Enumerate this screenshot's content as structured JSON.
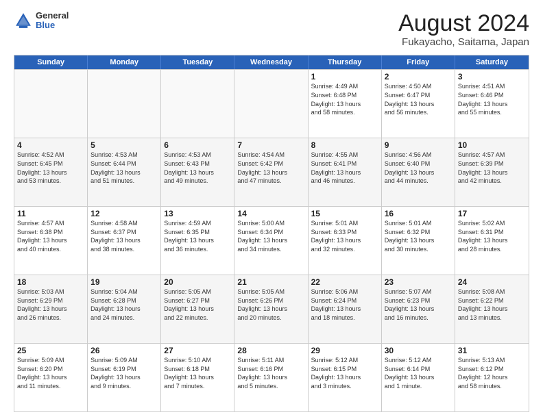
{
  "logo": {
    "general": "General",
    "blue": "Blue"
  },
  "title": "August 2024",
  "subtitle": "Fukayacho, Saitama, Japan",
  "header_days": [
    "Sunday",
    "Monday",
    "Tuesday",
    "Wednesday",
    "Thursday",
    "Friday",
    "Saturday"
  ],
  "weeks": [
    [
      {
        "num": "",
        "detail": ""
      },
      {
        "num": "",
        "detail": ""
      },
      {
        "num": "",
        "detail": ""
      },
      {
        "num": "",
        "detail": ""
      },
      {
        "num": "1",
        "detail": "Sunrise: 4:49 AM\nSunset: 6:48 PM\nDaylight: 13 hours\nand 58 minutes."
      },
      {
        "num": "2",
        "detail": "Sunrise: 4:50 AM\nSunset: 6:47 PM\nDaylight: 13 hours\nand 56 minutes."
      },
      {
        "num": "3",
        "detail": "Sunrise: 4:51 AM\nSunset: 6:46 PM\nDaylight: 13 hours\nand 55 minutes."
      }
    ],
    [
      {
        "num": "4",
        "detail": "Sunrise: 4:52 AM\nSunset: 6:45 PM\nDaylight: 13 hours\nand 53 minutes."
      },
      {
        "num": "5",
        "detail": "Sunrise: 4:53 AM\nSunset: 6:44 PM\nDaylight: 13 hours\nand 51 minutes."
      },
      {
        "num": "6",
        "detail": "Sunrise: 4:53 AM\nSunset: 6:43 PM\nDaylight: 13 hours\nand 49 minutes."
      },
      {
        "num": "7",
        "detail": "Sunrise: 4:54 AM\nSunset: 6:42 PM\nDaylight: 13 hours\nand 47 minutes."
      },
      {
        "num": "8",
        "detail": "Sunrise: 4:55 AM\nSunset: 6:41 PM\nDaylight: 13 hours\nand 46 minutes."
      },
      {
        "num": "9",
        "detail": "Sunrise: 4:56 AM\nSunset: 6:40 PM\nDaylight: 13 hours\nand 44 minutes."
      },
      {
        "num": "10",
        "detail": "Sunrise: 4:57 AM\nSunset: 6:39 PM\nDaylight: 13 hours\nand 42 minutes."
      }
    ],
    [
      {
        "num": "11",
        "detail": "Sunrise: 4:57 AM\nSunset: 6:38 PM\nDaylight: 13 hours\nand 40 minutes."
      },
      {
        "num": "12",
        "detail": "Sunrise: 4:58 AM\nSunset: 6:37 PM\nDaylight: 13 hours\nand 38 minutes."
      },
      {
        "num": "13",
        "detail": "Sunrise: 4:59 AM\nSunset: 6:35 PM\nDaylight: 13 hours\nand 36 minutes."
      },
      {
        "num": "14",
        "detail": "Sunrise: 5:00 AM\nSunset: 6:34 PM\nDaylight: 13 hours\nand 34 minutes."
      },
      {
        "num": "15",
        "detail": "Sunrise: 5:01 AM\nSunset: 6:33 PM\nDaylight: 13 hours\nand 32 minutes."
      },
      {
        "num": "16",
        "detail": "Sunrise: 5:01 AM\nSunset: 6:32 PM\nDaylight: 13 hours\nand 30 minutes."
      },
      {
        "num": "17",
        "detail": "Sunrise: 5:02 AM\nSunset: 6:31 PM\nDaylight: 13 hours\nand 28 minutes."
      }
    ],
    [
      {
        "num": "18",
        "detail": "Sunrise: 5:03 AM\nSunset: 6:29 PM\nDaylight: 13 hours\nand 26 minutes."
      },
      {
        "num": "19",
        "detail": "Sunrise: 5:04 AM\nSunset: 6:28 PM\nDaylight: 13 hours\nand 24 minutes."
      },
      {
        "num": "20",
        "detail": "Sunrise: 5:05 AM\nSunset: 6:27 PM\nDaylight: 13 hours\nand 22 minutes."
      },
      {
        "num": "21",
        "detail": "Sunrise: 5:05 AM\nSunset: 6:26 PM\nDaylight: 13 hours\nand 20 minutes."
      },
      {
        "num": "22",
        "detail": "Sunrise: 5:06 AM\nSunset: 6:24 PM\nDaylight: 13 hours\nand 18 minutes."
      },
      {
        "num": "23",
        "detail": "Sunrise: 5:07 AM\nSunset: 6:23 PM\nDaylight: 13 hours\nand 16 minutes."
      },
      {
        "num": "24",
        "detail": "Sunrise: 5:08 AM\nSunset: 6:22 PM\nDaylight: 13 hours\nand 13 minutes."
      }
    ],
    [
      {
        "num": "25",
        "detail": "Sunrise: 5:09 AM\nSunset: 6:20 PM\nDaylight: 13 hours\nand 11 minutes."
      },
      {
        "num": "26",
        "detail": "Sunrise: 5:09 AM\nSunset: 6:19 PM\nDaylight: 13 hours\nand 9 minutes."
      },
      {
        "num": "27",
        "detail": "Sunrise: 5:10 AM\nSunset: 6:18 PM\nDaylight: 13 hours\nand 7 minutes."
      },
      {
        "num": "28",
        "detail": "Sunrise: 5:11 AM\nSunset: 6:16 PM\nDaylight: 13 hours\nand 5 minutes."
      },
      {
        "num": "29",
        "detail": "Sunrise: 5:12 AM\nSunset: 6:15 PM\nDaylight: 13 hours\nand 3 minutes."
      },
      {
        "num": "30",
        "detail": "Sunrise: 5:12 AM\nSunset: 6:14 PM\nDaylight: 13 hours\nand 1 minute."
      },
      {
        "num": "31",
        "detail": "Sunrise: 5:13 AM\nSunset: 6:12 PM\nDaylight: 12 hours\nand 58 minutes."
      }
    ]
  ]
}
